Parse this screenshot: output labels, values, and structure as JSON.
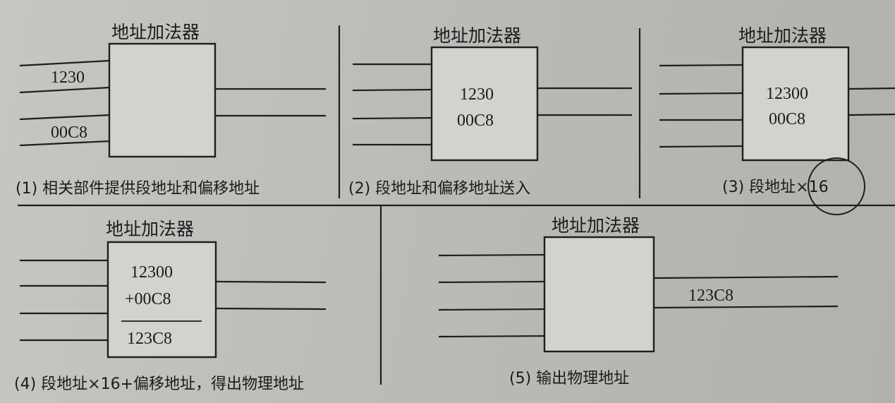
{
  "panel1": {
    "title": "地址加法器",
    "segment_value": "1230",
    "offset_value": "00C8",
    "caption": "(1) 相关部件提供段地址和偏移地址"
  },
  "panel2": {
    "title": "地址加法器",
    "segment_value": "1230",
    "offset_value": "00C8",
    "caption": "(2) 段地址和偏移地址送入"
  },
  "panel3": {
    "title": "地址加法器",
    "segment_value": "12300",
    "offset_value": "00C8",
    "caption": "(3) 段地址×16"
  },
  "panel4": {
    "title": "地址加法器",
    "addend_1": "12300",
    "addend_2": "+00C8",
    "sum": "123C8",
    "caption": "(4) 段地址×16+偏移地址，得出物理地址"
  },
  "panel5": {
    "title": "地址加法器",
    "output_value": "123C8",
    "caption": "(5) 输出物理地址"
  }
}
